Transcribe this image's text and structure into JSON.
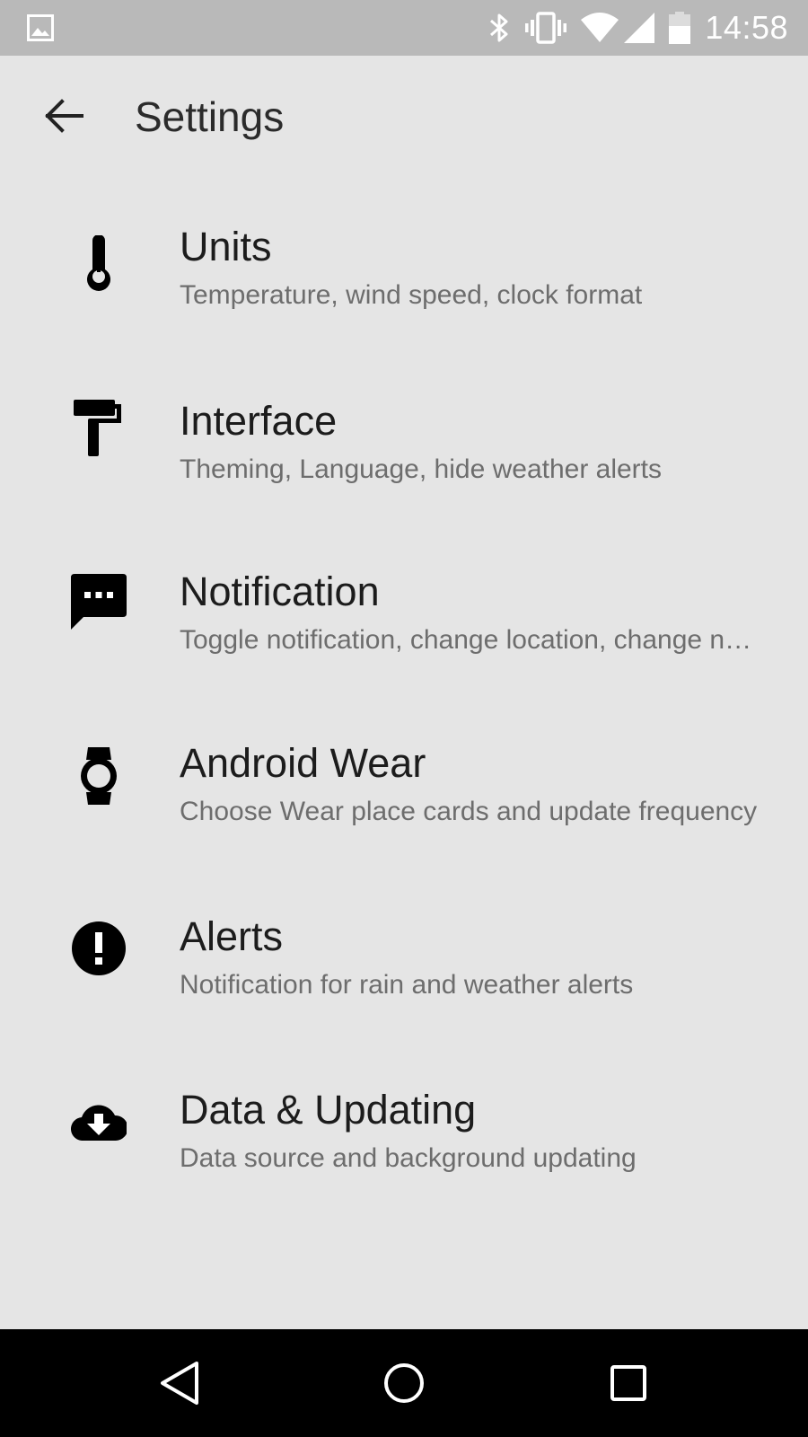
{
  "status_bar": {
    "time": "14:58",
    "icons": [
      "gallery-icon",
      "bluetooth-icon",
      "vibrate-icon",
      "wifi-icon",
      "signal-icon",
      "battery-icon"
    ]
  },
  "toolbar": {
    "title": "Settings",
    "back_icon": "arrow-left-icon"
  },
  "items": [
    {
      "title": "Units",
      "subtitle": "Temperature, wind speed, clock format",
      "icon": "thermometer-icon"
    },
    {
      "title": "Interface",
      "subtitle": "Theming, Language, hide weather alerts",
      "icon": "paint-roller-icon"
    },
    {
      "title": "Notification",
      "subtitle": "Toggle notification, change location, change notification style",
      "icon": "message-icon"
    },
    {
      "title": "Android Wear",
      "subtitle": "Choose Wear place cards and update frequency",
      "icon": "watch-icon"
    },
    {
      "title": "Alerts",
      "subtitle": "Notification for rain and weather alerts",
      "icon": "alert-circle-icon"
    },
    {
      "title": "Data & Updating",
      "subtitle": "Data source and background updating",
      "icon": "cloud-download-icon"
    }
  ],
  "nav_bar": {
    "buttons": [
      "back-triangle-icon",
      "home-circle-icon",
      "recents-square-icon"
    ]
  },
  "colors": {
    "background": "#e5e5e5",
    "status_bar": "#b9b9b9",
    "title_text": "#1c1c1c",
    "subtitle_text": "#6d6d6d",
    "nav_bar": "#000000"
  }
}
